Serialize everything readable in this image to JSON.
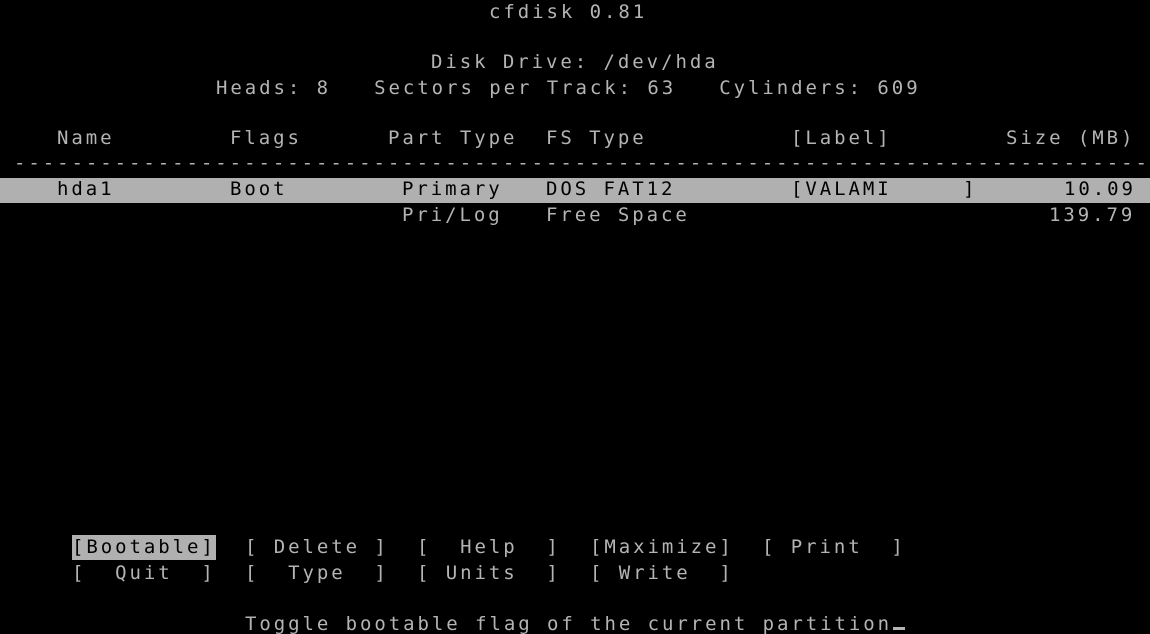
{
  "title": "cfdisk 0.81",
  "disk": {
    "drive": "Disk Drive: /dev/hda",
    "geometry": "Heads: 8   Sectors per Track: 63   Cylinders: 609"
  },
  "table": {
    "headers": {
      "name": "Name",
      "flags": "Flags",
      "part_type": "Part Type",
      "fs_type": "FS Type",
      "label": "[Label]",
      "size": "Size (MB)"
    },
    "separator": "-------------------------------------------------------------------------------",
    "rows": [
      {
        "name": "hda1",
        "flags": "Boot",
        "part_type": "Primary",
        "fs_type": "DOS FAT12",
        "label": "[VALAMI",
        "label_end": "]",
        "size": "10.09",
        "selected": true
      },
      {
        "name": "",
        "flags": "",
        "part_type": "Pri/Log",
        "fs_type": "Free Space",
        "label": "",
        "label_end": "",
        "size": "139.79",
        "selected": false
      }
    ]
  },
  "menu": {
    "row1": [
      "[Bootable]",
      "[ Delete ]",
      "[  Help  ]",
      "[Maximize]",
      "[ Print  ]"
    ],
    "row2": [
      "[  Quit  ]",
      "[  Type  ]",
      "[ Units  ]",
      "[ Write  ]"
    ],
    "selected": "[Bootable]"
  },
  "status": "Toggle bootable flag of the current partition",
  "colors": {
    "foreground": "#b4b4b4",
    "background": "#000000",
    "highlight": "#b0b0b0"
  }
}
